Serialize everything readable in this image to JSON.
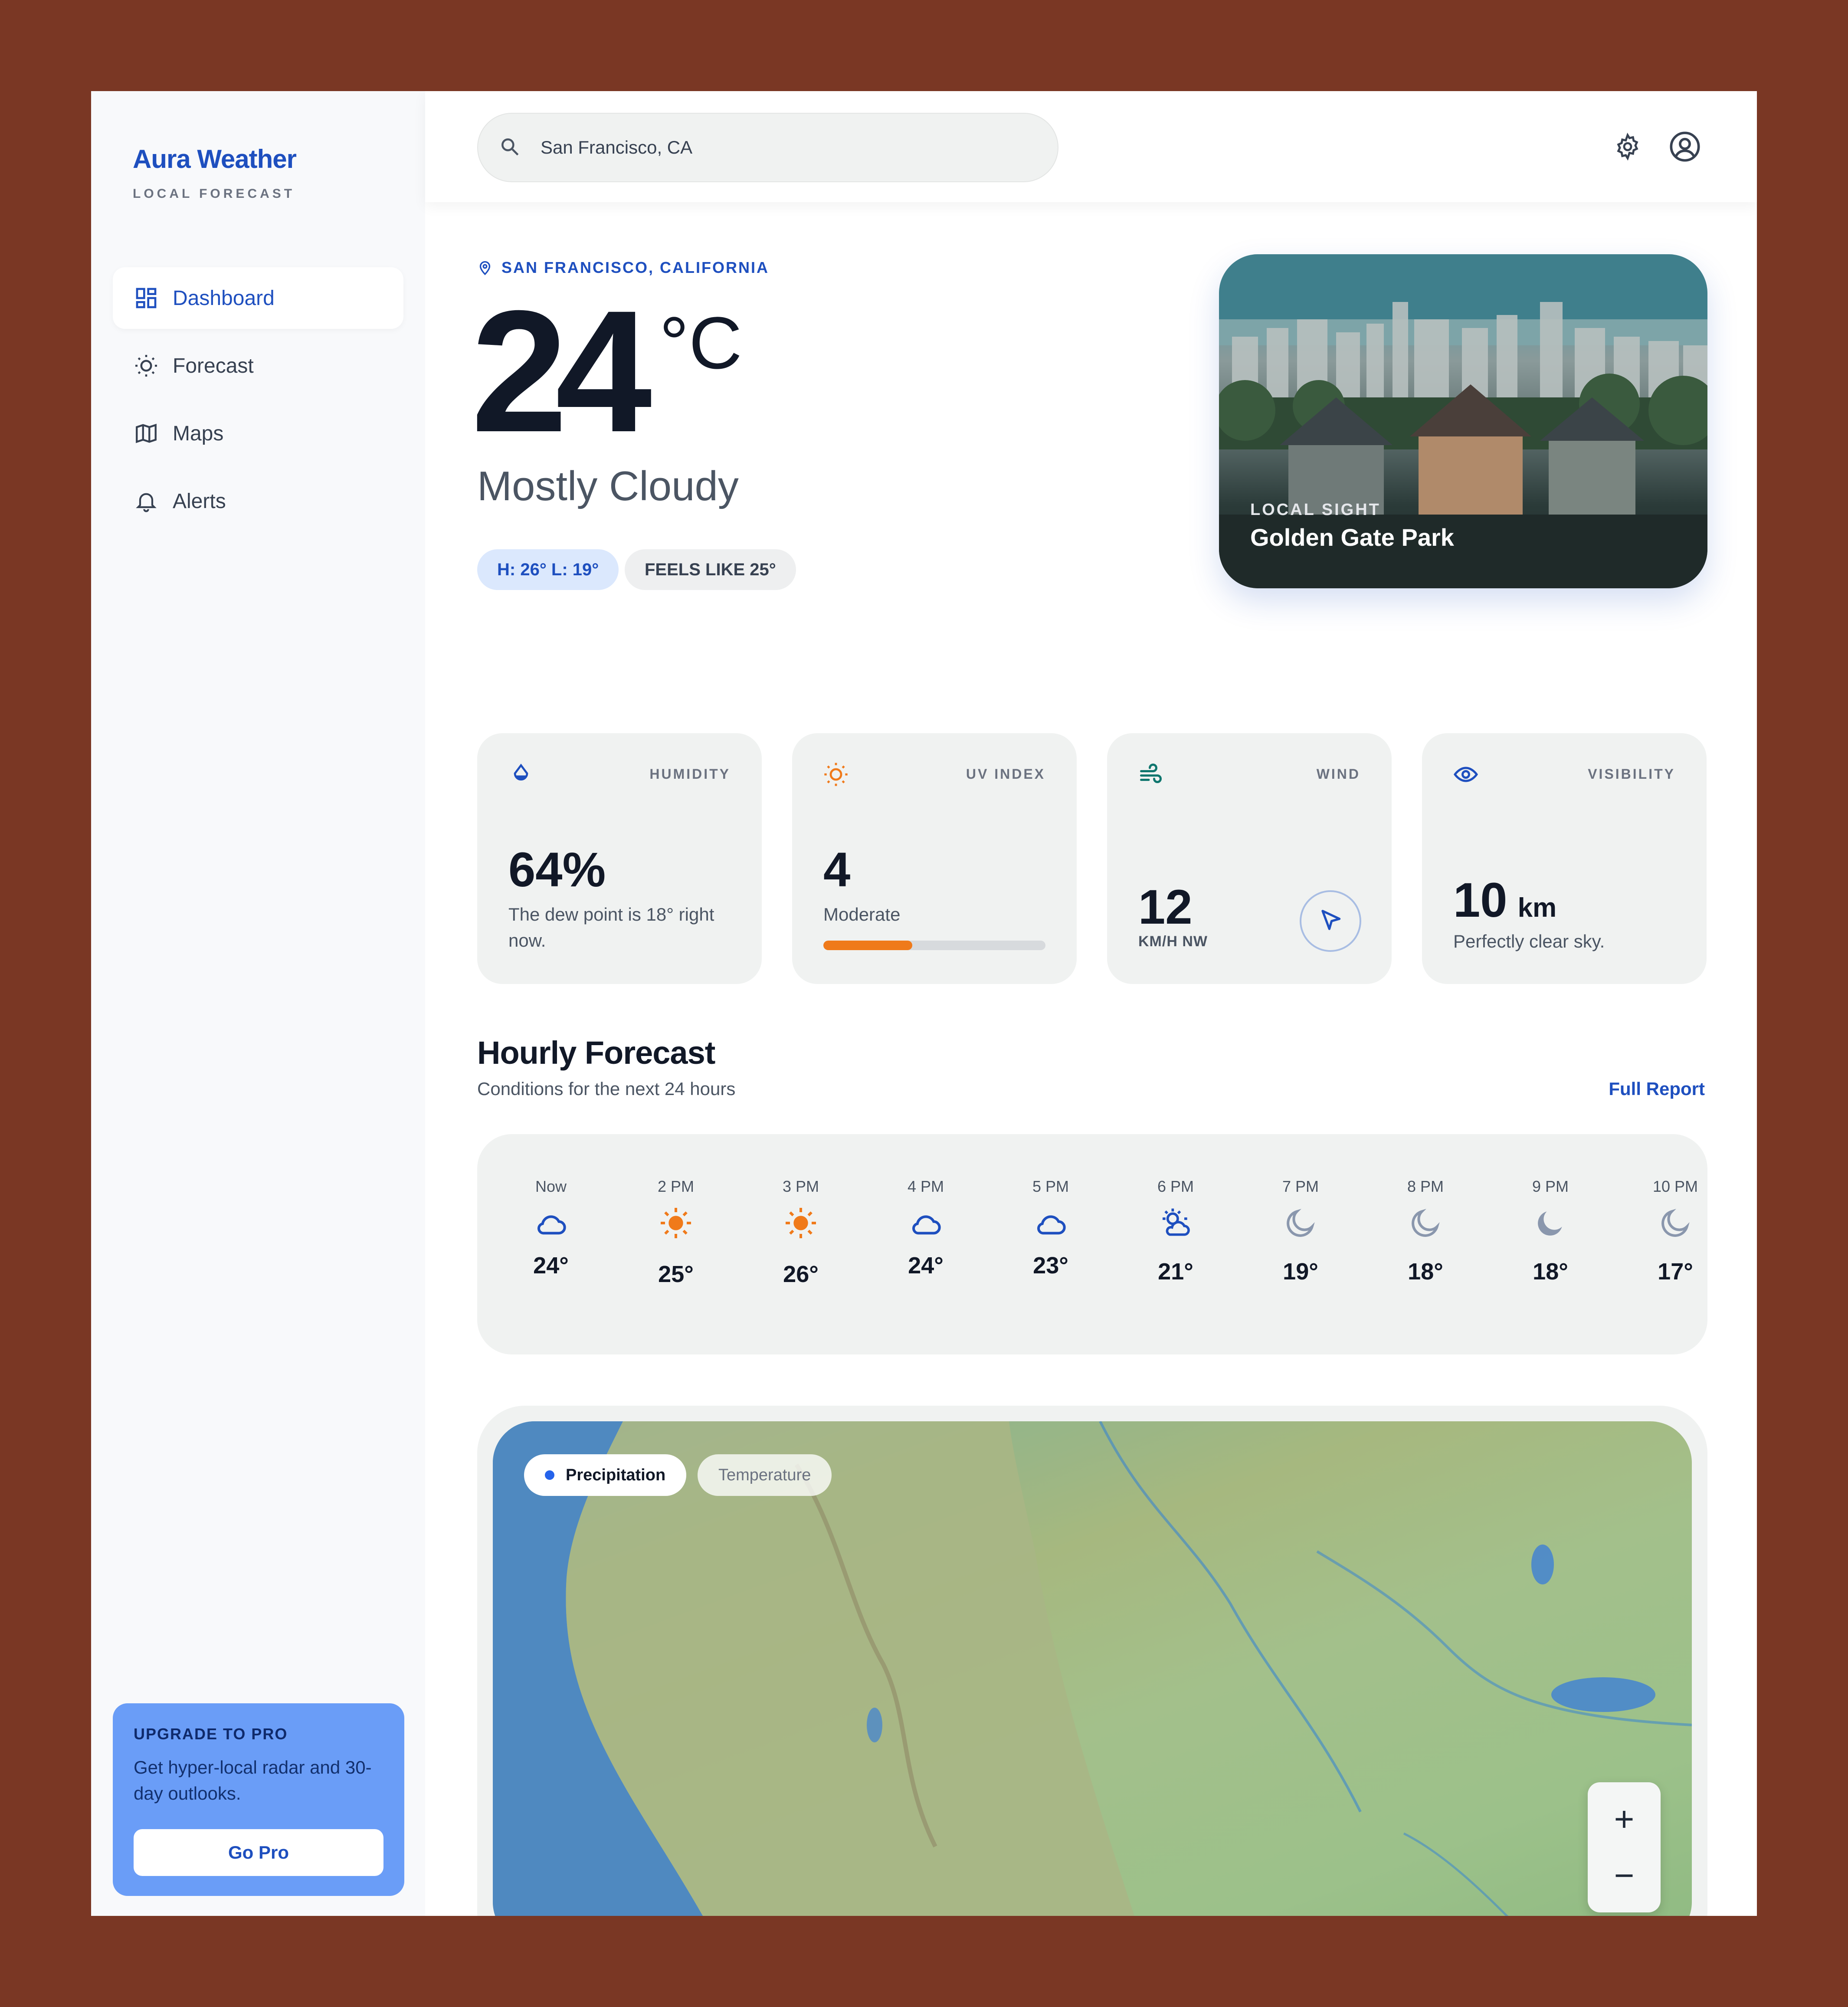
{
  "sidebar": {
    "brand": "Aura Weather",
    "brand_sub": "LOCAL FORECAST",
    "items": [
      {
        "label": "Dashboard",
        "icon": "dashboard-icon",
        "active": true
      },
      {
        "label": "Forecast",
        "icon": "sun-icon",
        "active": false
      },
      {
        "label": "Maps",
        "icon": "map-icon",
        "active": false
      },
      {
        "label": "Alerts",
        "icon": "bell-icon",
        "active": false
      }
    ],
    "promo": {
      "title": "UPGRADE TO PRO",
      "text": "Get hyper-local radar and 30-day outlooks.",
      "button": "Go Pro"
    }
  },
  "header": {
    "search_value": "San Francisco, CA",
    "icons": [
      "gear-icon",
      "user-icon"
    ]
  },
  "current": {
    "location": "SAN FRANCISCO, CALIFORNIA",
    "temp": "24",
    "unit": "°C",
    "condition": "Mostly Cloudy",
    "high_low": "H: 26° L: 19°",
    "feels_like": "FEELS LIKE 25°"
  },
  "sight": {
    "label": "LOCAL SIGHT",
    "name": "Golden Gate Park"
  },
  "stats": {
    "humidity": {
      "label": "HUMIDITY",
      "value": "64%",
      "sub": "The dew point is 18° right now."
    },
    "uv": {
      "label": "UV INDEX",
      "value": "4",
      "sub": "Moderate",
      "level_percent": 40
    },
    "wind": {
      "label": "WIND",
      "value": "12",
      "sub": "KM/H NW"
    },
    "visibility": {
      "label": "VISIBILITY",
      "value": "10",
      "unit": "km",
      "sub": "Perfectly clear sky."
    }
  },
  "hourly": {
    "title": "Hourly Forecast",
    "subtitle": "Conditions for the next 24 hours",
    "link": "Full Report",
    "hours": [
      {
        "time": "Now",
        "temp": "24°",
        "icon": "cloud-icon"
      },
      {
        "time": "2 PM",
        "temp": "25°",
        "icon": "sun-icon"
      },
      {
        "time": "3 PM",
        "temp": "26°",
        "icon": "sun-icon"
      },
      {
        "time": "4 PM",
        "temp": "24°",
        "icon": "cloud-icon"
      },
      {
        "time": "5 PM",
        "temp": "23°",
        "icon": "cloud-icon"
      },
      {
        "time": "6 PM",
        "temp": "21°",
        "icon": "partly-cloudy-icon"
      },
      {
        "time": "7 PM",
        "temp": "19°",
        "icon": "moon-outline-icon"
      },
      {
        "time": "8 PM",
        "temp": "18°",
        "icon": "moon-outline-icon"
      },
      {
        "time": "9 PM",
        "temp": "18°",
        "icon": "moon-filled-icon"
      },
      {
        "time": "10 PM",
        "temp": "17°",
        "icon": "moon-outline-icon"
      }
    ]
  },
  "map": {
    "tabs": [
      "Precipitation",
      "Temperature"
    ],
    "active_tab": "Precipitation",
    "zoom_in": "+",
    "zoom_out": "−"
  },
  "colors": {
    "accent": "#1e4fbf",
    "uv_fill": "#ef7a1a",
    "sun": "#f07a1a",
    "moon": "#8a97ad"
  }
}
